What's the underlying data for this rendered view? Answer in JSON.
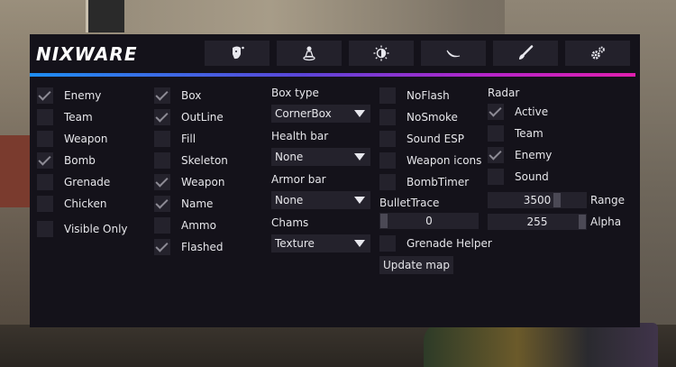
{
  "logo": "NIXWARE",
  "tabs": [
    {
      "icon": "face-icon"
    },
    {
      "icon": "player-icon"
    },
    {
      "icon": "brightness-icon"
    },
    {
      "icon": "moon-icon"
    },
    {
      "icon": "brush-icon"
    },
    {
      "icon": "settings-gears-icon"
    }
  ],
  "accent_colors": [
    "#1e8ef2",
    "#5b45d8",
    "#b425c9",
    "#e01fae"
  ],
  "col1": [
    {
      "label": "Enemy",
      "checked": true
    },
    {
      "label": "Team",
      "checked": false
    },
    {
      "label": "Weapon",
      "checked": false
    },
    {
      "label": "Bomb",
      "checked": true
    },
    {
      "label": "Grenade",
      "checked": false
    },
    {
      "label": "Chicken",
      "checked": false
    },
    {
      "label": "Visible Only",
      "checked": false
    }
  ],
  "col2": [
    {
      "label": "Box",
      "checked": true
    },
    {
      "label": "OutLine",
      "checked": true
    },
    {
      "label": "Fill",
      "checked": false
    },
    {
      "label": "Skeleton",
      "checked": false
    },
    {
      "label": "Weapon",
      "checked": true
    },
    {
      "label": "Name",
      "checked": true
    },
    {
      "label": "Ammo",
      "checked": false
    },
    {
      "label": "Flashed",
      "checked": true
    }
  ],
  "col3": {
    "box_type": {
      "label": "Box type",
      "value": "CornerBox"
    },
    "health_bar": {
      "label": "Health bar",
      "value": "None"
    },
    "armor_bar": {
      "label": "Armor bar",
      "value": "None"
    },
    "chams": {
      "label": "Chams",
      "value": "Texture"
    }
  },
  "col4": {
    "items": [
      {
        "label": "NoFlash",
        "checked": false
      },
      {
        "label": "NoSmoke",
        "checked": false
      },
      {
        "label": "Sound ESP",
        "checked": false
      },
      {
        "label": "Weapon icons",
        "checked": false
      },
      {
        "label": "BombTimer",
        "checked": false
      }
    ],
    "bullet_trace": {
      "label": "BulletTrace",
      "value": "0",
      "fraction": 0.0
    },
    "grenade_helper": {
      "label": "Grenade Helper",
      "checked": false
    },
    "update_map": "Update map"
  },
  "col5": {
    "title": "Radar",
    "items": [
      {
        "label": "Active",
        "checked": true
      },
      {
        "label": "Team",
        "checked": false
      },
      {
        "label": "Enemy",
        "checked": true
      },
      {
        "label": "Sound",
        "checked": false
      }
    ],
    "range": {
      "label": "Range",
      "value": "3500",
      "fraction": 0.72
    },
    "alpha": {
      "label": "Alpha",
      "value": "255",
      "fraction": 1.0
    }
  }
}
